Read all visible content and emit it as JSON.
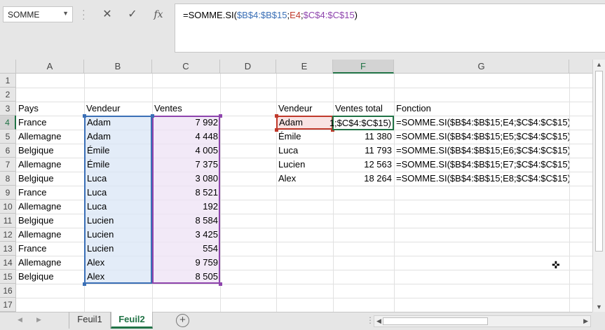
{
  "formula_bar": {
    "name_box": "SOMME",
    "cancel_glyph": "✕",
    "enter_glyph": "✓",
    "fx_label": "fx",
    "formula_parts": [
      "=SOMME.SI(",
      "$B$4:$B$15",
      ";",
      "E4",
      ";",
      "$C$4:$C$15",
      ")"
    ]
  },
  "grid": {
    "columns": [
      "A",
      "B",
      "C",
      "D",
      "E",
      "F",
      "G"
    ],
    "selected_column": "F",
    "rows": [
      "1",
      "2",
      "3",
      "4",
      "5",
      "6",
      "7",
      "8",
      "9",
      "10",
      "11",
      "12",
      "13",
      "14",
      "15",
      "16",
      "17"
    ],
    "selected_row": "4"
  },
  "table_left": {
    "headers": [
      "Pays",
      "Vendeur",
      "Ventes"
    ],
    "rows": [
      [
        "France",
        "Adam",
        "7 992"
      ],
      [
        "Allemagne",
        "Adam",
        "4 448"
      ],
      [
        "Belgique",
        "Émile",
        "4 005"
      ],
      [
        "Allemagne",
        "Émile",
        "7 375"
      ],
      [
        "Belgique",
        "Luca",
        "3 080"
      ],
      [
        "France",
        "Luca",
        "8 521"
      ],
      [
        "Allemagne",
        "Luca",
        "192"
      ],
      [
        "Belgique",
        "Lucien",
        "8 584"
      ],
      [
        "Allemagne",
        "Lucien",
        "3 425"
      ],
      [
        "France",
        "Lucien",
        "554"
      ],
      [
        "Allemagne",
        "Alex",
        "9 759"
      ],
      [
        "Belgique",
        "Alex",
        "8 505"
      ]
    ]
  },
  "table_right": {
    "headers": [
      "Vendeur",
      "Ventes total",
      "Fonction"
    ],
    "active_cell_display": "1;$C$4:$C$15)",
    "rows": [
      [
        "Adam",
        "",
        "=SOMME.SI($B$4:$B$15;E4;$C$4:$C$15)"
      ],
      [
        "Émile",
        "11 380",
        "=SOMME.SI($B$4:$B$15;E5;$C$4:$C$15)"
      ],
      [
        "Luca",
        "11 793",
        "=SOMME.SI($B$4:$B$15;E6;$C$4:$C$15)"
      ],
      [
        "Lucien",
        "12 563",
        "=SOMME.SI($B$4:$B$15;E7;$C$4:$C$15)"
      ],
      [
        "Alex",
        "18 264",
        "=SOMME.SI($B$4:$B$15;E8;$C$4:$C$15)"
      ]
    ]
  },
  "sheet_tabs": {
    "tabs": [
      "Feuil1",
      "Feuil2"
    ],
    "active": "Feuil2"
  },
  "colors": {
    "range_1": "#3a6fb6",
    "range_2": "#c0392b",
    "range_3": "#8e44ad",
    "excel_green": "#217346"
  }
}
